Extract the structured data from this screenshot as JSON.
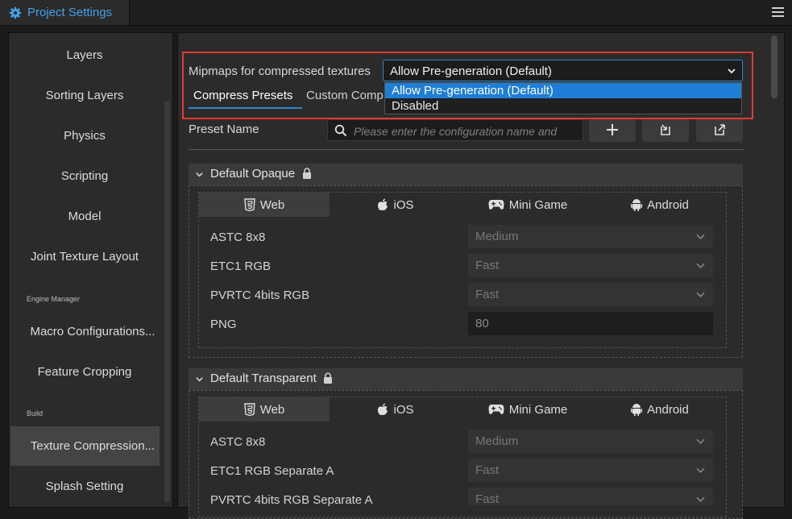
{
  "window": {
    "tab_title": "Project Settings"
  },
  "sidebar": {
    "items": [
      {
        "label": "Layers"
      },
      {
        "label": "Sorting Layers"
      },
      {
        "label": "Physics"
      },
      {
        "label": "Scripting"
      },
      {
        "label": "Model"
      },
      {
        "label": "Joint Texture Layout"
      },
      {
        "label": "Macro Configurations..."
      },
      {
        "label": "Feature Cropping"
      },
      {
        "label": "Texture Compression..."
      },
      {
        "label": "Splash Setting"
      }
    ],
    "groups": [
      "Engine Manager",
      "Build"
    ],
    "active_item": "Texture Compression..."
  },
  "mipmaps": {
    "label": "Mipmaps for compressed textures",
    "selected": "Allow Pre-generation (Default)",
    "options": [
      "Allow Pre-generation (Default)",
      "Disabled"
    ]
  },
  "tabs": {
    "active": "Compress Presets",
    "other": "Custom Comp"
  },
  "preset": {
    "label": "Preset Name",
    "search_placeholder": "Please enter the configuration name and"
  },
  "platform_tabs": [
    "Web",
    "iOS",
    "Mini Game",
    "Android"
  ],
  "sections": [
    {
      "title": "Default Opaque",
      "rows": [
        {
          "label": "ASTC 8x8",
          "value": "Medium",
          "kind": "select"
        },
        {
          "label": "ETC1 RGB",
          "value": "Fast",
          "kind": "select"
        },
        {
          "label": "PVRTC 4bits RGB",
          "value": "Fast",
          "kind": "select"
        },
        {
          "label": "PNG",
          "value": "80",
          "kind": "number"
        }
      ]
    },
    {
      "title": "Default Transparent",
      "rows": [
        {
          "label": "ASTC 8x8",
          "value": "Medium",
          "kind": "select"
        },
        {
          "label": "ETC1 RGB Separate A",
          "value": "Fast",
          "kind": "select"
        },
        {
          "label": "PVRTC 4bits RGB Separate A",
          "value": "Fast",
          "kind": "select"
        }
      ]
    }
  ],
  "colors": {
    "accent": "#2f86c9",
    "highlight": "#e53935",
    "selected_option": "#1e7ed6"
  }
}
